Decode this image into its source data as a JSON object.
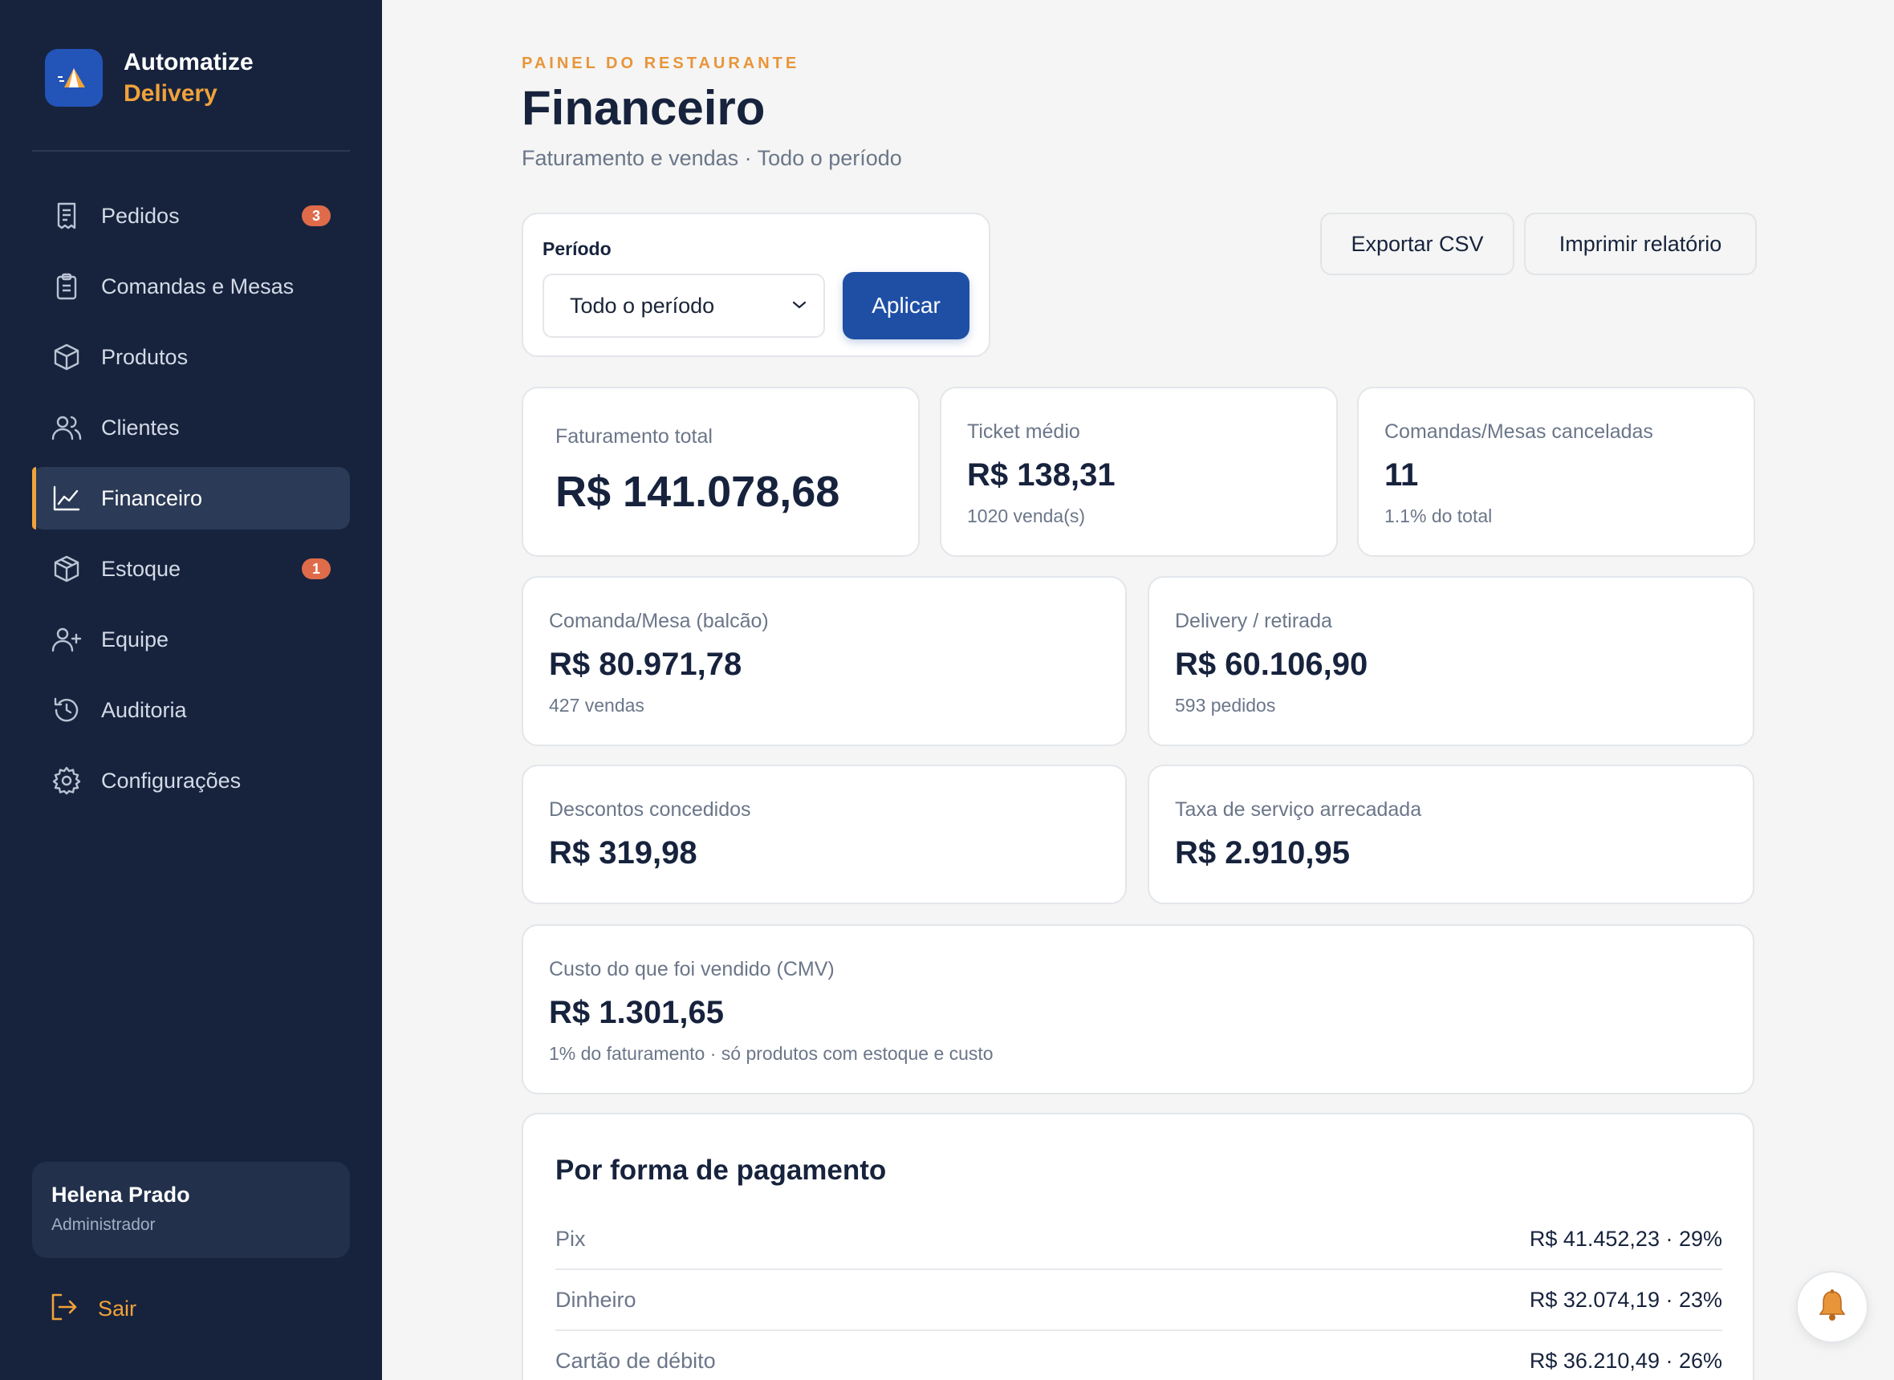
{
  "brand": {
    "name": "Automatize",
    "sub": "Delivery"
  },
  "nav": [
    {
      "label": "Pedidos",
      "icon": "receipt-icon",
      "badge": "3"
    },
    {
      "label": "Comandas e Mesas",
      "icon": "clipboard-icon"
    },
    {
      "label": "Produtos",
      "icon": "box-icon"
    },
    {
      "label": "Clientes",
      "icon": "users-icon"
    },
    {
      "label": "Financeiro",
      "icon": "chart-line-icon",
      "active": true
    },
    {
      "label": "Estoque",
      "icon": "box-icon",
      "badge": "1"
    },
    {
      "label": "Equipe",
      "icon": "user-plus-icon"
    },
    {
      "label": "Auditoria",
      "icon": "history-icon"
    },
    {
      "label": "Configurações",
      "icon": "gear-icon"
    }
  ],
  "user": {
    "name": "Helena Prado",
    "role": "Administrador"
  },
  "logout": {
    "label": "Sair"
  },
  "header": {
    "eyebrow": "PAINEL DO RESTAURANTE",
    "title": "Financeiro",
    "subtitle": "Faturamento e vendas · Todo o período"
  },
  "filter": {
    "label": "Período",
    "selected": "Todo o período",
    "apply": "Aplicar"
  },
  "actions": {
    "export": "Exportar CSV",
    "print": "Imprimir relatório"
  },
  "cards": {
    "faturamento": {
      "label": "Faturamento total",
      "value": "R$ 141.078,68"
    },
    "ticket": {
      "label": "Ticket médio",
      "value": "R$ 138,31",
      "note": "1020 venda(s)"
    },
    "canceladas": {
      "label": "Comandas/Mesas canceladas",
      "value": "11",
      "note": "1.1% do total"
    },
    "comanda": {
      "label": "Comanda/Mesa (balcão)",
      "value": "R$ 80.971,78",
      "note": "427 vendas"
    },
    "delivery": {
      "label": "Delivery / retirada",
      "value": "R$ 60.106,90",
      "note": "593 pedidos"
    },
    "descontos": {
      "label": "Descontos concedidos",
      "value": "R$ 319,98"
    },
    "taxa": {
      "label": "Taxa de serviço arrecadada",
      "value": "R$ 2.910,95"
    },
    "cmv": {
      "label": "Custo do que foi vendido (CMV)",
      "value": "R$ 1.301,65",
      "note": "1% do faturamento · só produtos com estoque e custo"
    }
  },
  "payments": {
    "title": "Por forma de pagamento",
    "rows": [
      {
        "name": "Pix",
        "amount": "R$ 41.452,23 · 29%"
      },
      {
        "name": "Dinheiro",
        "amount": "R$ 32.074,19 · 23%"
      },
      {
        "name": "Cartão de débito",
        "amount": "R$ 36.210,49 · 26%"
      }
    ]
  },
  "colors": {
    "sidebar": "#17233d",
    "accent": "#f0a23b",
    "primary": "#1f4fa5",
    "badge": "#df6b4a"
  }
}
